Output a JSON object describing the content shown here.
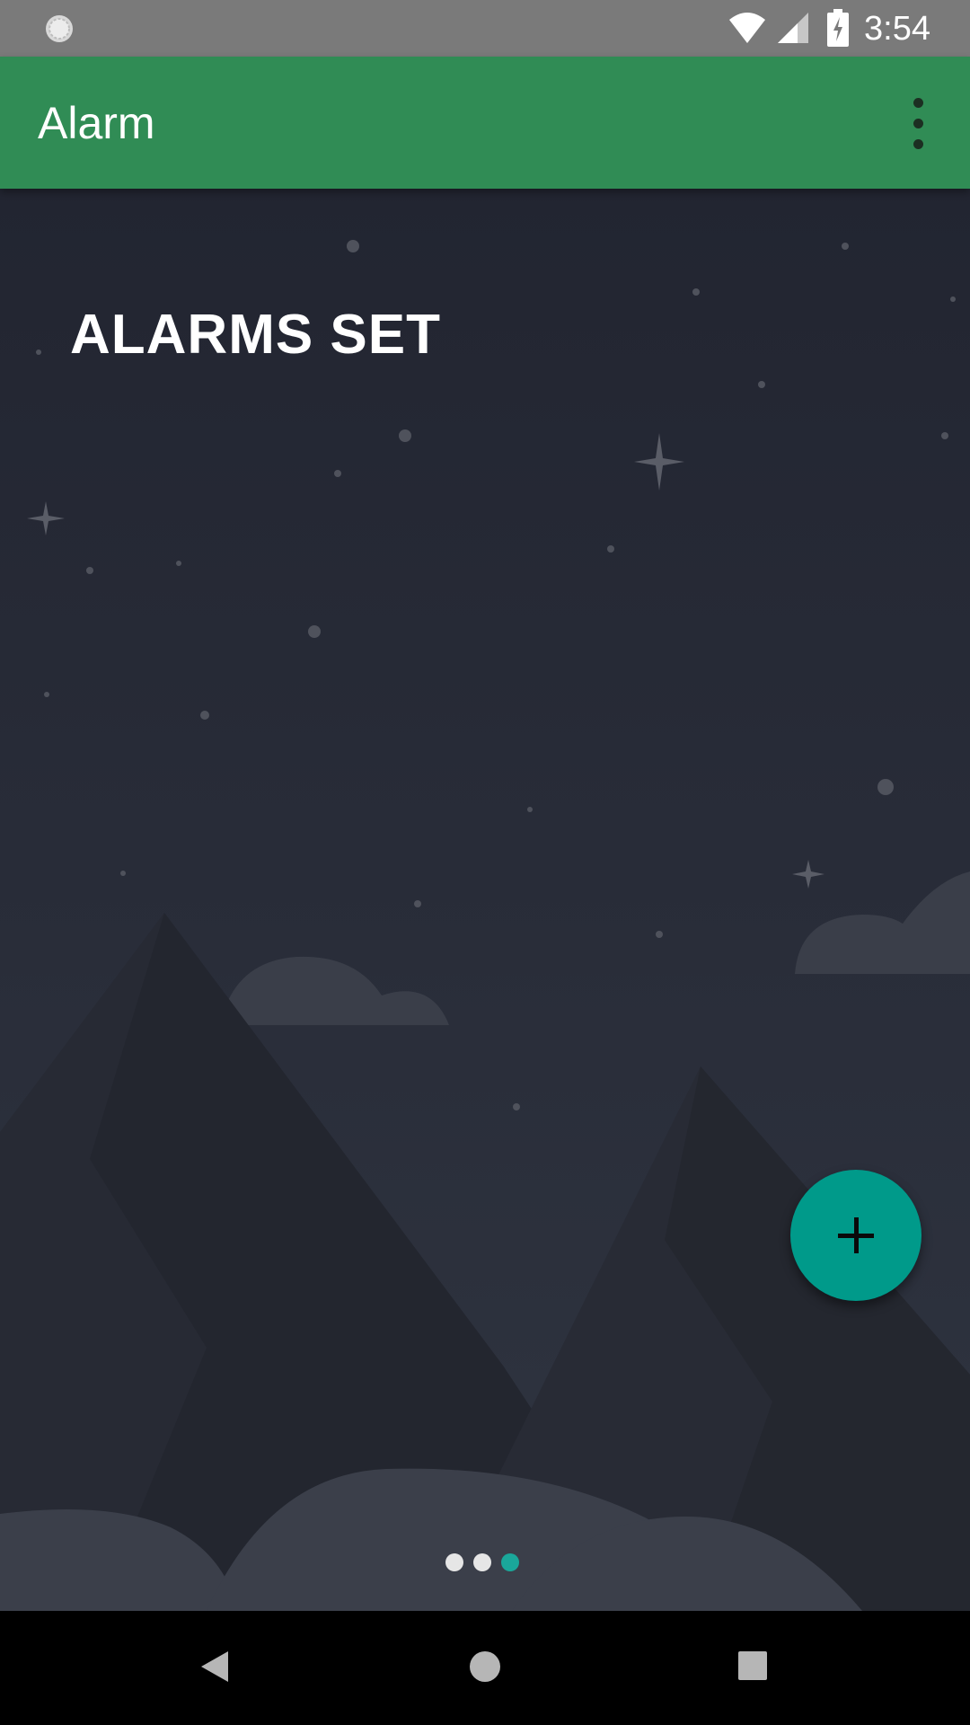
{
  "status_bar": {
    "time": "3:54",
    "icons": [
      "loading-icon",
      "wifi-icon",
      "signal-icon",
      "battery-charging-icon"
    ]
  },
  "app_bar": {
    "title": "Alarm",
    "menu_icon": "more-vert-icon"
  },
  "main": {
    "heading": "ALARMS SET",
    "fab_icon": "add-icon",
    "page_indicator": {
      "count": 3,
      "active_index": 2
    }
  },
  "nav_bar": {
    "buttons": [
      "back-icon",
      "home-icon",
      "recents-icon"
    ]
  },
  "colors": {
    "status_bar": "#7a7a7a",
    "app_bar": "#308c55",
    "background": "#23262f",
    "fab": "#009a8a",
    "dot_inactive": "#e6e6e6",
    "dot_active": "#1aa79a"
  }
}
